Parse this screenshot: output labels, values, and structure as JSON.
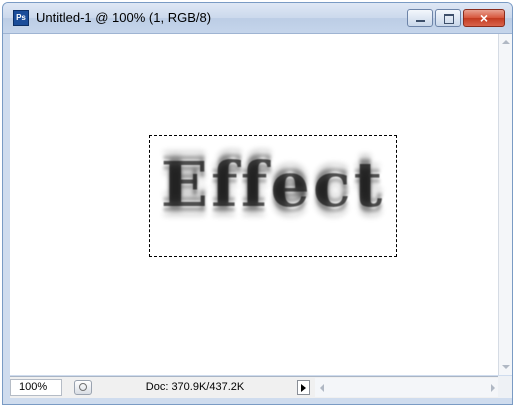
{
  "window": {
    "title": "Untitled-1 @ 100% (1, RGB/8)",
    "app_icon_label": "Ps",
    "close_glyph": "×"
  },
  "canvas": {
    "text": "Effect"
  },
  "statusbar": {
    "zoom_value": "100%",
    "doc_info": "Doc: 370.9K/437.2K"
  },
  "colors": {
    "title_bar": "#cbd9ec",
    "close_button": "#c23a20",
    "canvas_bg": "#ffffff"
  }
}
